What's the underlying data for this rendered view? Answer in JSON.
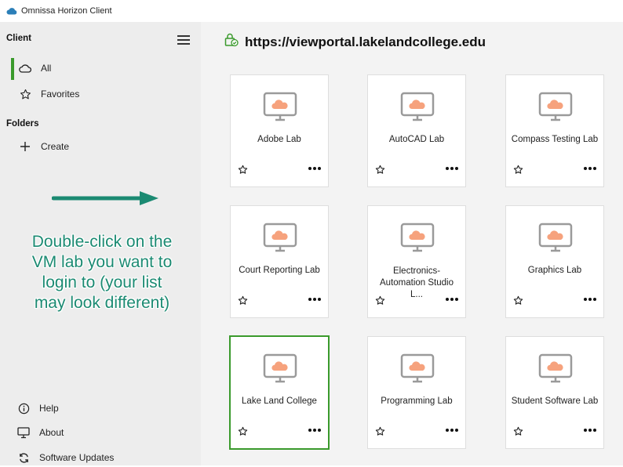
{
  "window": {
    "title": "Omnissa Horizon Client"
  },
  "sidebar": {
    "client_heading": "Client",
    "items": [
      {
        "label": "All",
        "icon": "cloud-icon",
        "active": true
      },
      {
        "label": "Favorites",
        "icon": "star-icon",
        "active": false
      }
    ],
    "folders_heading": "Folders",
    "create_label": "Create",
    "bottom_items": [
      {
        "label": "Help",
        "icon": "info-icon"
      },
      {
        "label": "About",
        "icon": "monitor-icon"
      },
      {
        "label": "Software Updates",
        "icon": "refresh-icon"
      }
    ]
  },
  "annotation": {
    "text": "Double-click on the VM lab you want to login to (your list may look different)",
    "color": "#1b8a72"
  },
  "main": {
    "server_url": "https://viewportal.lakelandcollege.edu",
    "desktops": [
      {
        "name": "Adobe Lab",
        "selected": false
      },
      {
        "name": "AutoCAD Lab",
        "selected": false
      },
      {
        "name": "Compass Testing Lab",
        "selected": false
      },
      {
        "name": "Court Reporting Lab",
        "selected": false
      },
      {
        "name": "Electronics-Automation Studio L...",
        "selected": false
      },
      {
        "name": "Graphics Lab",
        "selected": false
      },
      {
        "name": "Lake Land College",
        "selected": true
      },
      {
        "name": "Programming Lab",
        "selected": false
      },
      {
        "name": "Student Software Lab",
        "selected": false
      }
    ]
  },
  "colors": {
    "accent": "#3a9a2c",
    "cloud": "#f6a27d",
    "annotation": "#1b8a72"
  }
}
